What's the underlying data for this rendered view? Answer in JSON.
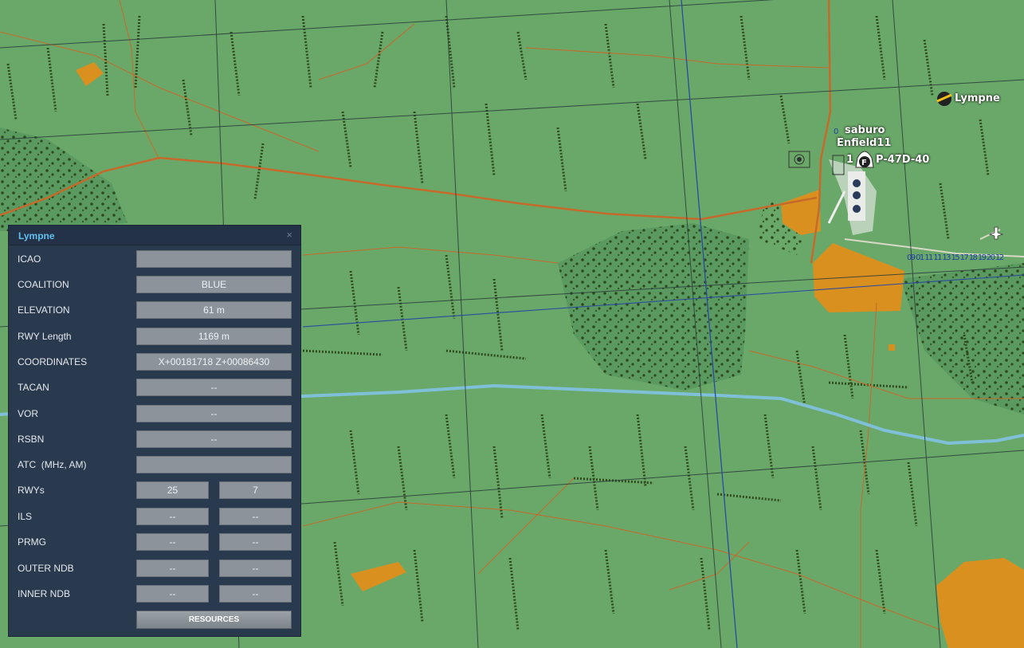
{
  "map": {
    "airfield_label": "Lympne",
    "pilot_name": "saburo",
    "group_name": "Enfield11",
    "unit_index": "1",
    "unit_marker_letter": "F",
    "aircraft_type": "P-47D-40",
    "unit_number": "0",
    "route_markings": "09 01 11 11 13 15 17 18 19 20 12",
    "colors": {
      "terrain": "#6aa86a",
      "forest": "#2e4a1c",
      "urban": "#d9901f",
      "river": "#7fc0d8",
      "roads": "#c56a2a",
      "grid": "#2a3a3a",
      "meridian": "#2a4aa0"
    }
  },
  "panel": {
    "title": "Lympne",
    "close_icon": "×",
    "rows": [
      {
        "label": "ICAO",
        "value": ""
      },
      {
        "label": "COALITION",
        "value": "BLUE"
      },
      {
        "label": "ELEVATION",
        "value": "61 m"
      },
      {
        "label": "RWY Length",
        "value": "1169 m"
      },
      {
        "label": "COORDINATES",
        "value": "X+00181718 Z+00086430"
      },
      {
        "label": "TACAN",
        "value": "--"
      },
      {
        "label": "VOR",
        "value": "--"
      },
      {
        "label": "RSBN",
        "value": "--"
      },
      {
        "label": "ATC  (MHz, AM)",
        "value": ""
      }
    ],
    "pair_rows": [
      {
        "label": "RWYs",
        "value1": "25",
        "value2": "7"
      },
      {
        "label": "ILS",
        "value1": "--",
        "value2": "--"
      },
      {
        "label": "PRMG",
        "value1": "--",
        "value2": "--"
      },
      {
        "label": "OUTER NDB",
        "value1": "--",
        "value2": "--"
      },
      {
        "label": "INNER NDB",
        "value1": "--",
        "value2": "--"
      }
    ],
    "resources_label": "RESOURCES"
  }
}
